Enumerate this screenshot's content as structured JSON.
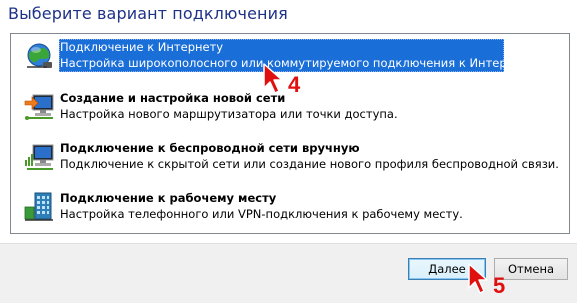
{
  "heading": "Выберите вариант подключения",
  "options": [
    {
      "title": "Подключение к Интернету",
      "desc": "Настройка широкополосного или коммутируемого подключения к Интернету.",
      "icon": "globe-network-icon",
      "selected": true
    },
    {
      "title": "Создание и настройка новой сети",
      "desc": "Настройка нового маршрутизатора или точки доступа.",
      "icon": "new-network-icon",
      "selected": false
    },
    {
      "title": "Подключение к беспроводной сети вручную",
      "desc": "Подключение к скрытой сети или создание нового профиля беспроводной связи.",
      "icon": "wireless-network-icon",
      "selected": false
    },
    {
      "title": "Подключение к рабочему месту",
      "desc": "Настройка телефонного или VPN-подключения к рабочему месту.",
      "icon": "workplace-icon",
      "selected": false
    }
  ],
  "buttons": {
    "next": "Далее",
    "cancel": "Отмена"
  },
  "annotations": {
    "step4": "4",
    "step5": "5"
  },
  "colors": {
    "selection": "#1a6ed8",
    "heading": "#1e3287",
    "marker": "#e01010"
  }
}
